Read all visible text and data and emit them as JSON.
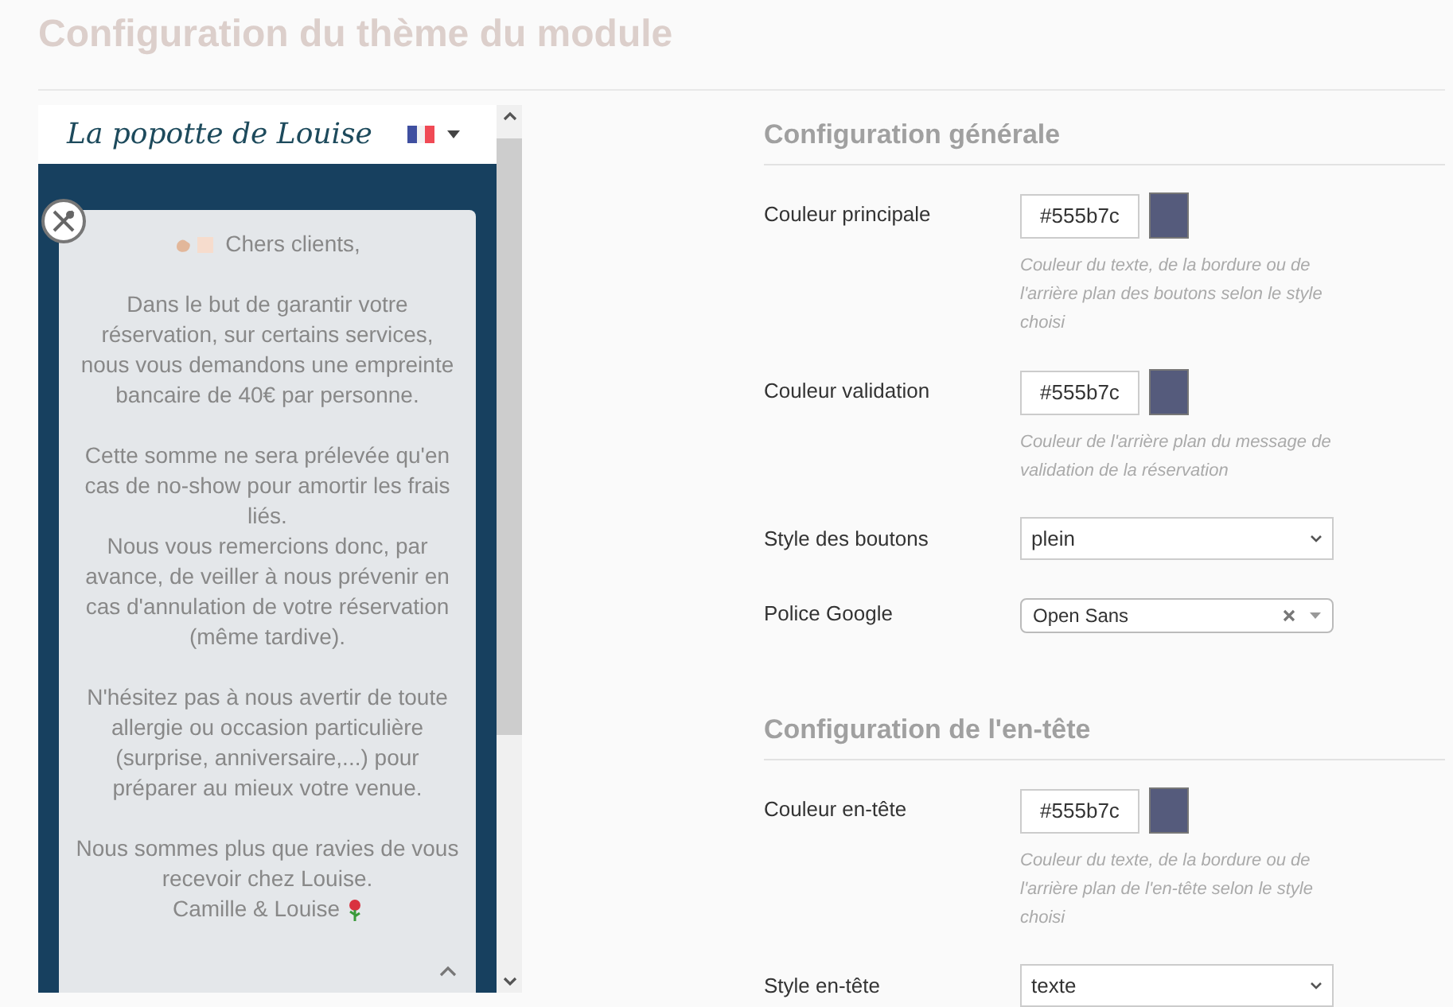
{
  "title": "Configuration du thème du module",
  "preview": {
    "logo": "La popotte de Louise",
    "message": {
      "greeting": "Chers clients,",
      "paragraphs": [
        "Dans le but de garantir votre réservation, sur certains services, nous vous demandons une empreinte bancaire de 40€ par personne.",
        "Cette somme ne sera prélevée qu'en cas de no-show pour amortir les frais liés.\nNous vous remercions donc, par avance, de veiller à nous prévenir en cas d'annulation de votre réservation (même tardive).",
        "N'hésitez pas à nous avertir de toute allergie ou occasion particulière (surprise, anniversaire,...) pour préparer au mieux votre venue.",
        "Nous sommes plus que ravies de vous recevoir chez Louise."
      ],
      "signature": "Camille & Louise"
    }
  },
  "sections": [
    {
      "title": "Configuration générale",
      "fields": [
        {
          "kind": "color",
          "label": "Couleur principale",
          "value": "#555b7c",
          "color": "#555b7c",
          "help": "Couleur du texte, de la bordure ou de l'arrière plan des boutons selon le style choisi"
        },
        {
          "kind": "color",
          "label": "Couleur validation",
          "value": "#555b7c",
          "color": "#555b7c",
          "help": "Couleur de l'arrière plan du message de validation de la réservation"
        },
        {
          "kind": "select",
          "label": "Style des boutons",
          "value": "plein"
        },
        {
          "kind": "combobox",
          "label": "Police Google",
          "value": "Open Sans"
        }
      ]
    },
    {
      "title": "Configuration de l'en-tête",
      "fields": [
        {
          "kind": "color",
          "label": "Couleur en-tête",
          "value": "#555b7c",
          "color": "#555b7c",
          "help": "Couleur du texte, de la bordure ou de l'arrière plan de l'en-tête selon le style choisi"
        },
        {
          "kind": "select",
          "label": "Style en-tête",
          "value": "texte"
        }
      ]
    }
  ]
}
